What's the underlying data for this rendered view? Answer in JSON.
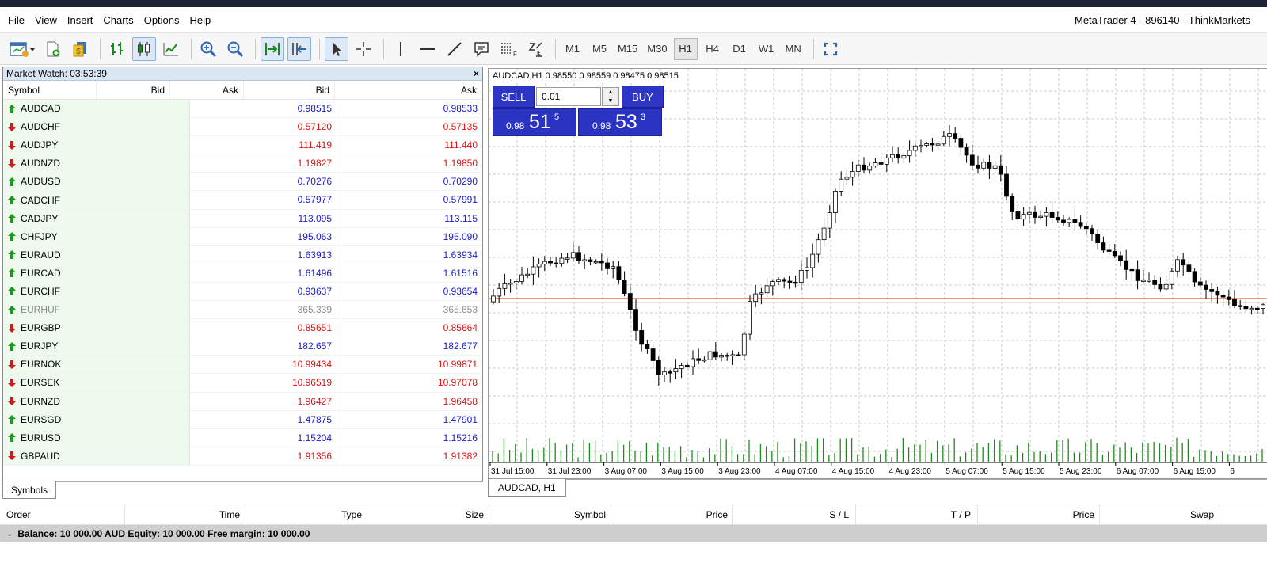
{
  "menu": [
    "File",
    "View",
    "Insert",
    "Charts",
    "Options",
    "Help"
  ],
  "window_title": "MetaTrader 4 - 896140 - ThinkMarkets",
  "timeframes": [
    "M1",
    "M5",
    "M15",
    "M30",
    "H1",
    "H4",
    "D1",
    "W1",
    "MN"
  ],
  "active_timeframe": "H1",
  "market_watch": {
    "title": "Market Watch: 03:53:39",
    "columns": [
      "Symbol",
      "Bid",
      "Ask",
      "Bid",
      "Ask"
    ],
    "rows": [
      {
        "symbol": "AUDCAD",
        "bid": "0.98515",
        "ask": "0.98533",
        "dir": "up"
      },
      {
        "symbol": "AUDCHF",
        "bid": "0.57120",
        "ask": "0.57135",
        "dir": "down"
      },
      {
        "symbol": "AUDJPY",
        "bid": "111.419",
        "ask": "111.440",
        "dir": "down"
      },
      {
        "symbol": "AUDNZD",
        "bid": "1.19827",
        "ask": "1.19850",
        "dir": "down"
      },
      {
        "symbol": "AUDUSD",
        "bid": "0.70276",
        "ask": "0.70290",
        "dir": "up"
      },
      {
        "symbol": "CADCHF",
        "bid": "0.57977",
        "ask": "0.57991",
        "dir": "up"
      },
      {
        "symbol": "CADJPY",
        "bid": "113.095",
        "ask": "113.115",
        "dir": "up"
      },
      {
        "symbol": "CHFJPY",
        "bid": "195.063",
        "ask": "195.090",
        "dir": "up"
      },
      {
        "symbol": "EURAUD",
        "bid": "1.63913",
        "ask": "1.63934",
        "dir": "up"
      },
      {
        "symbol": "EURCAD",
        "bid": "1.61496",
        "ask": "1.61516",
        "dir": "up"
      },
      {
        "symbol": "EURCHF",
        "bid": "0.93637",
        "ask": "0.93654",
        "dir": "up"
      },
      {
        "symbol": "EURHUF",
        "bid": "365.339",
        "ask": "365.653",
        "dir": "grey"
      },
      {
        "symbol": "EURGBP",
        "bid": "0.85651",
        "ask": "0.85664",
        "dir": "down"
      },
      {
        "symbol": "EURJPY",
        "bid": "182.657",
        "ask": "182.677",
        "dir": "up"
      },
      {
        "symbol": "EURNOK",
        "bid": "10.99434",
        "ask": "10.99871",
        "dir": "down"
      },
      {
        "symbol": "EURSEK",
        "bid": "10.96519",
        "ask": "10.97078",
        "dir": "down"
      },
      {
        "symbol": "EURNZD",
        "bid": "1.96427",
        "ask": "1.96458",
        "dir": "down"
      },
      {
        "symbol": "EURSGD",
        "bid": "1.47875",
        "ask": "1.47901",
        "dir": "up"
      },
      {
        "symbol": "EURUSD",
        "bid": "1.15204",
        "ask": "1.15216",
        "dir": "up"
      },
      {
        "symbol": "GBPAUD",
        "bid": "1.91356",
        "ask": "1.91382",
        "dir": "down"
      }
    ],
    "tab": "Symbols"
  },
  "chart": {
    "ohlc_label": "AUDCAD,H1  0.98550 0.98559 0.98475 0.98515",
    "sell_label": "SELL",
    "buy_label": "BUY",
    "lot_value": "0.01",
    "sell_price": {
      "prefix": "0.98",
      "big": "51",
      "sup": "5"
    },
    "buy_price": {
      "prefix": "0.98",
      "big": "53",
      "sup": "3"
    },
    "time_labels": [
      "31 Jul 15:00",
      "31 Jul 23:00",
      "3 Aug 07:00",
      "3 Aug 15:00",
      "3 Aug 23:00",
      "4 Aug 07:00",
      "4 Aug 15:00",
      "4 Aug 23:00",
      "5 Aug 07:00",
      "5 Aug 15:00",
      "5 Aug 23:00",
      "6 Aug 07:00",
      "6 Aug 15:00",
      "6"
    ],
    "tab": "AUDCAD, H1",
    "colors": {
      "candle_up": "#ffffff",
      "candle_down": "#000000",
      "volume": "#1f8a1f",
      "price_line": "#e07a50"
    }
  },
  "terminal": {
    "columns": [
      "Order",
      "Time",
      "Type",
      "Size",
      "Symbol",
      "Price",
      "S / L",
      "T / P",
      "Price",
      "Swap"
    ],
    "balance": "Balance: 10 000.00 AUD  Equity: 10 000.00  Free margin: 10 000.00"
  }
}
